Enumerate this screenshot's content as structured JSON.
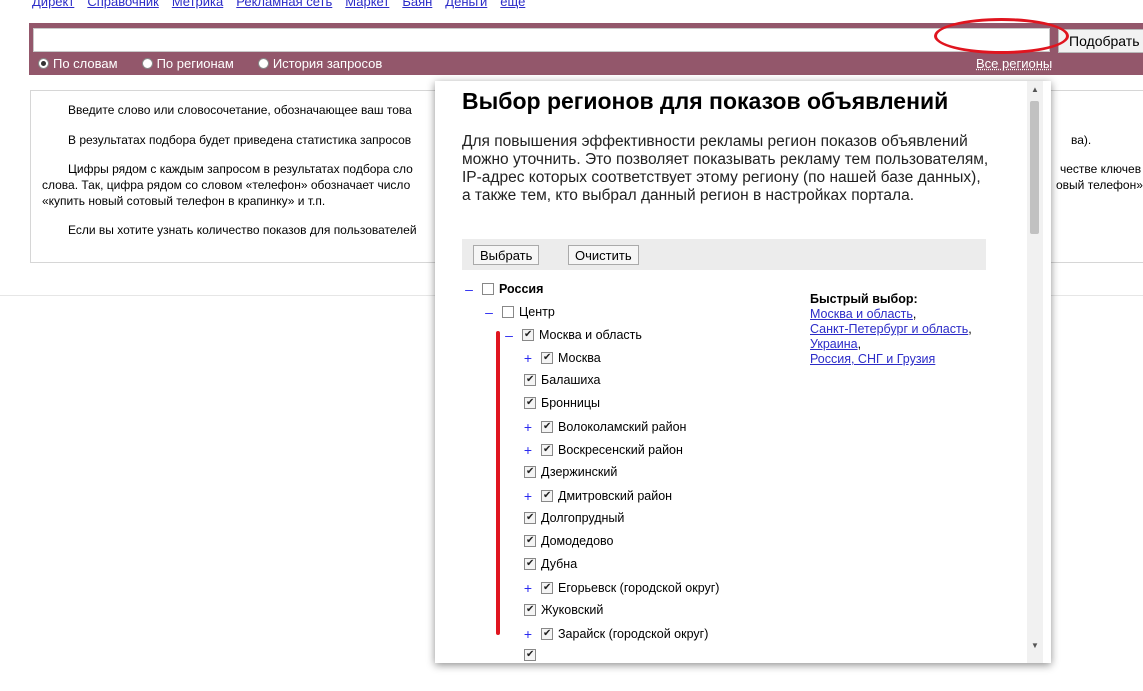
{
  "nav": [
    "Директ",
    "Справочник",
    "Метрика",
    "Рекламная сеть",
    "Маркет",
    "Баян",
    "Деньги",
    "еще"
  ],
  "search": {
    "value": "",
    "submit_label": "Подобрать",
    "radios": [
      {
        "label": "По словам",
        "checked": true
      },
      {
        "label": "По регионам",
        "checked": false
      },
      {
        "label": "История запросов",
        "checked": false
      }
    ],
    "all_regions_label": "Все регионы"
  },
  "intro": {
    "p1": "Введите слово или словосочетание, обозначающее ваш това",
    "p2": "В результатах подбора будет приведена статистика запросов",
    "p2_right": "ва).",
    "p3a": "Цифры рядом с каждым запросом в результатах подбора сло",
    "p3a_right": "честве ключев",
    "p3b": "слова. Так, цифра рядом со словом «телефон» обозначает число",
    "p3b_right": "овый телефон»,",
    "p3c": "«купить новый сотовый телефон в крапинку» и т.п.",
    "p4": "Если вы хотите узнать количество показов для пользователей"
  },
  "modal": {
    "title": "Выбор регионов для показов объявлений",
    "description": "Для повышения эффективности рекламы регион показов объявлений можно уточнить. Это позволяет показывать рекламу тем пользователям, IP-адрес которых соответствует этому региону (по нашей базе данных), а также тем, кто выбрал данный регион в настройках портала.",
    "select_button": "Выбрать",
    "clear_button": "Очистить",
    "quick": {
      "title": "Быстрый выбор:",
      "links": [
        "Москва и область",
        "Санкт-Петербург и область",
        "Украина",
        "Россия, СНГ и Грузия"
      ]
    },
    "tree": [
      {
        "label": "Россия",
        "toggle": "–",
        "checked": false,
        "level": 0
      },
      {
        "label": "Центр",
        "toggle": "–",
        "checked": false,
        "level": 1
      },
      {
        "label": "Москва и область",
        "toggle": "–",
        "checked": true,
        "level": 2
      },
      {
        "label": "Москва",
        "toggle": "+",
        "checked": true,
        "level": 3
      },
      {
        "label": "Балашиха",
        "toggle": "",
        "checked": true,
        "level": 3
      },
      {
        "label": "Бронницы",
        "toggle": "",
        "checked": true,
        "level": 3
      },
      {
        "label": "Волоколамский район",
        "toggle": "+",
        "checked": true,
        "level": 3
      },
      {
        "label": "Воскресенский район",
        "toggle": "+",
        "checked": true,
        "level": 3
      },
      {
        "label": "Дзержинский",
        "toggle": "",
        "checked": true,
        "level": 3
      },
      {
        "label": "Дмитровский район",
        "toggle": "+",
        "checked": true,
        "level": 3
      },
      {
        "label": "Долгопрудный",
        "toggle": "",
        "checked": true,
        "level": 3
      },
      {
        "label": "Домодедово",
        "toggle": "",
        "checked": true,
        "level": 3
      },
      {
        "label": "Дубна",
        "toggle": "",
        "checked": true,
        "level": 3
      },
      {
        "label": "Егорьевск (городской округ)",
        "toggle": "+",
        "checked": true,
        "level": 3
      },
      {
        "label": "Жуковский",
        "toggle": "",
        "checked": true,
        "level": 3
      },
      {
        "label": "Зарайск (городской округ)",
        "toggle": "+",
        "checked": true,
        "level": 3
      },
      {
        "label": "",
        "toggle": "",
        "checked": true,
        "level": 3
      }
    ]
  }
}
